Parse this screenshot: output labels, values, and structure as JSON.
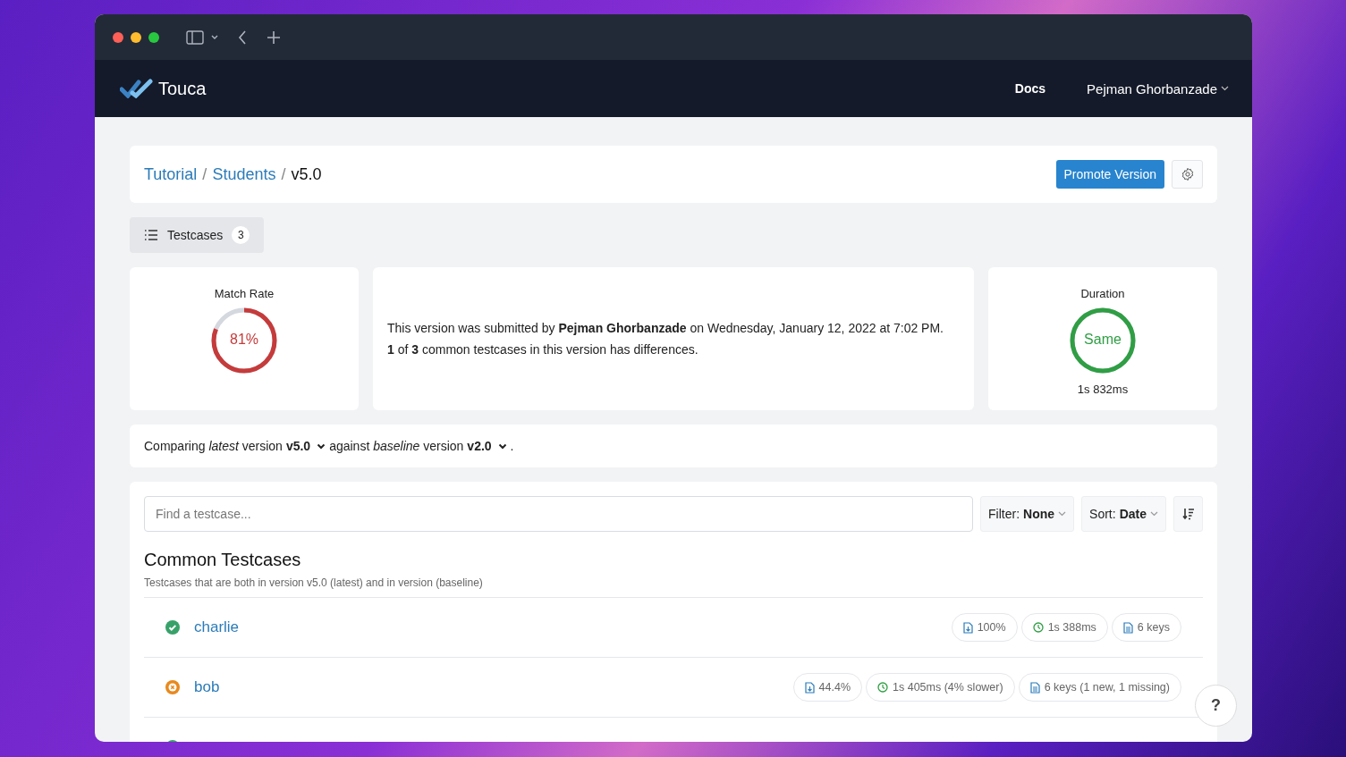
{
  "navbar": {
    "brand": "Touca",
    "links": [
      {
        "label": "Docs",
        "kind": "link"
      },
      {
        "label": "Pejman Ghorbanzade",
        "kind": "menu"
      }
    ]
  },
  "breadcrumb": {
    "separator": "/",
    "items": [
      {
        "label": "Tutorial",
        "link": true
      },
      {
        "label": "Students",
        "link": true
      },
      {
        "label": "v5.0",
        "link": false
      }
    ]
  },
  "actions": {
    "promote": "Promote Version"
  },
  "tabs": [
    {
      "label": "Testcases",
      "count": "3",
      "selected": true
    }
  ],
  "match_rate": {
    "title": "Match Rate",
    "value": "81%",
    "level": 0.81,
    "color": "#c53b3b"
  },
  "summary": {
    "lines": [
      "This version was submitted by **Pejman Ghorbanzade** on Wednesday, January 12, 2022 at 7:02 PM.",
      "**1** of **3** common testcases in this version has differences."
    ]
  },
  "duration": {
    "title": "Duration",
    "value": "Same",
    "level": 1,
    "color": "#2f9e44",
    "reading": "1s 832ms"
  },
  "comparison": {
    "prefix": "Comparing *latest* version",
    "latest": "v5.0",
    "middle": "against *baseline* version",
    "baseline": "v2.0",
    "suffix": "."
  },
  "search": {
    "placeholder": "Find a testcase..."
  },
  "filter": "Filter: **None**",
  "sort": "Sort: **Date**",
  "section": {
    "title": "Common Testcases",
    "subtitle": "Testcases that are both in version v5.0 (latest) and in version (baseline)"
  },
  "testcases": [
    {
      "name": "charlie",
      "passed": true,
      "chips": [
        {
          "kind": "match",
          "text": "100%"
        },
        {
          "kind": "time",
          "text": "1s 388ms"
        },
        {
          "kind": "keys",
          "text": "6 keys"
        }
      ]
    },
    {
      "name": "bob",
      "passed": false,
      "chips": [
        {
          "kind": "match",
          "text": "44.4%"
        },
        {
          "kind": "time",
          "text": "1s 405ms (4% slower)"
        },
        {
          "kind": "keys",
          "text": "6 keys (1 new, 1 missing)"
        }
      ]
    },
    {
      "passed": true
    }
  ],
  "help": "?"
}
